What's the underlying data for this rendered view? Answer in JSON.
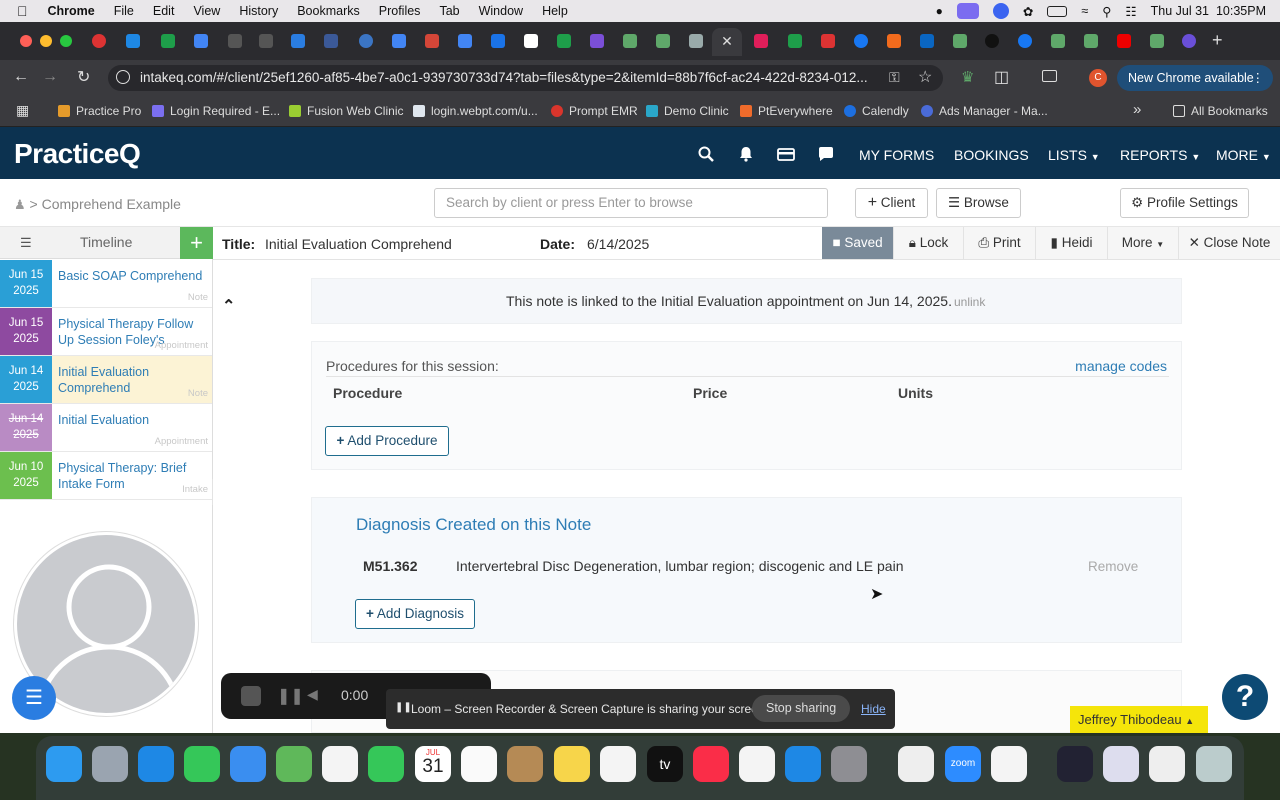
{
  "macos_menu": {
    "apple_icon": "apple-icon",
    "app_name": "Chrome",
    "items": [
      "File",
      "Edit",
      "View",
      "History",
      "Bookmarks",
      "Profiles",
      "Tab",
      "Window",
      "Help"
    ],
    "datetime": "Thu Jul 31  10:35PM"
  },
  "browser": {
    "url": "intakeq.com/#/client/25ef1260-af85-4be7-a0c1-939730733d74?tab=files&type=2&itemId=88b7f6cf-ac24-422d-8234-012...",
    "new_chrome_label": "New Chrome available",
    "profile_letter": "C",
    "bookmarks": [
      "Practice Pro",
      "Login Required - E...",
      "Fusion Web Clinic",
      "login.webpt.com/u...",
      "Prompt EMR",
      "Demo Clinic",
      "PtEverywhere",
      "Calendly",
      "Ads Manager - Ma..."
    ],
    "all_bookmarks": "All Bookmarks"
  },
  "app": {
    "logo": "PracticeQ",
    "nav": [
      "MY FORMS",
      "BOOKINGS",
      "LISTS",
      "REPORTS",
      "MORE"
    ],
    "breadcrumb": "> Comprehend Example",
    "search_placeholder": "Search by client or press Enter to browse",
    "client_btn": "Client",
    "browse_btn": "Browse",
    "profile_settings": "Profile Settings"
  },
  "timeline": {
    "header": "Timeline",
    "add_symbol": "+",
    "items": [
      {
        "date1": "Jun 15",
        "date2": "2025",
        "title": "Basic SOAP Comprehend",
        "kind": "Note",
        "color": "#2a9fd6"
      },
      {
        "date1": "Jun 15",
        "date2": "2025",
        "title": "Physical Therapy Follow Up Session Foley's",
        "kind": "Appointment",
        "color": "#8e4aa0"
      },
      {
        "date1": "Jun 14",
        "date2": "2025",
        "title": "Initial Evaluation Comprehend",
        "kind": "Note",
        "color": "#2a9fd6"
      },
      {
        "date1": "Jun 14",
        "date2": "2025",
        "title": "Initial Evaluation",
        "kind": "Appointment",
        "color": "#b98bc4"
      },
      {
        "date1": "Jun 10",
        "date2": "2025",
        "title": "Physical Therapy: Brief Intake Form",
        "kind": "Intake",
        "color": "#6cbf4e"
      }
    ]
  },
  "note": {
    "title_label": "Title:",
    "title_value": "Initial Evaluation Comprehend",
    "date_label": "Date:",
    "date_value": "6/14/2025",
    "buttons": {
      "saved": "Saved",
      "lock": "Lock",
      "print": "Print",
      "heidi": "Heidi",
      "more": "More",
      "close": "Close Note"
    },
    "linked_text": "This note is linked to the Initial Evaluation appointment on Jun 14, 2025.",
    "unlink": "unlink",
    "procedures_label": "Procedures for this session:",
    "manage_codes": "manage codes",
    "columns": [
      "Procedure",
      "Price",
      "Units"
    ],
    "add_procedure": "Add Procedure",
    "diagnosis_title": "Diagnosis Created on this Note",
    "diagnosis": {
      "code": "M51.362",
      "description": "Intervertebral Disc Degeneration, lumbar region; discogenic and LE pain",
      "remove": "Remove"
    },
    "add_diagnosis": "Add Diagnosis"
  },
  "loom": {
    "timer": "0:00",
    "sharing_text": "Loom – Screen Recorder & Screen Capture is sharing your screen.",
    "stop": "Stop sharing",
    "hide": "Hide"
  },
  "user_chip": "Jeffrey Thibodeau",
  "help_symbol": "?",
  "dock": {
    "calendar_month": "JUL",
    "calendar_day": "31",
    "tv_label": "tv",
    "zoom_label": "zoom"
  }
}
